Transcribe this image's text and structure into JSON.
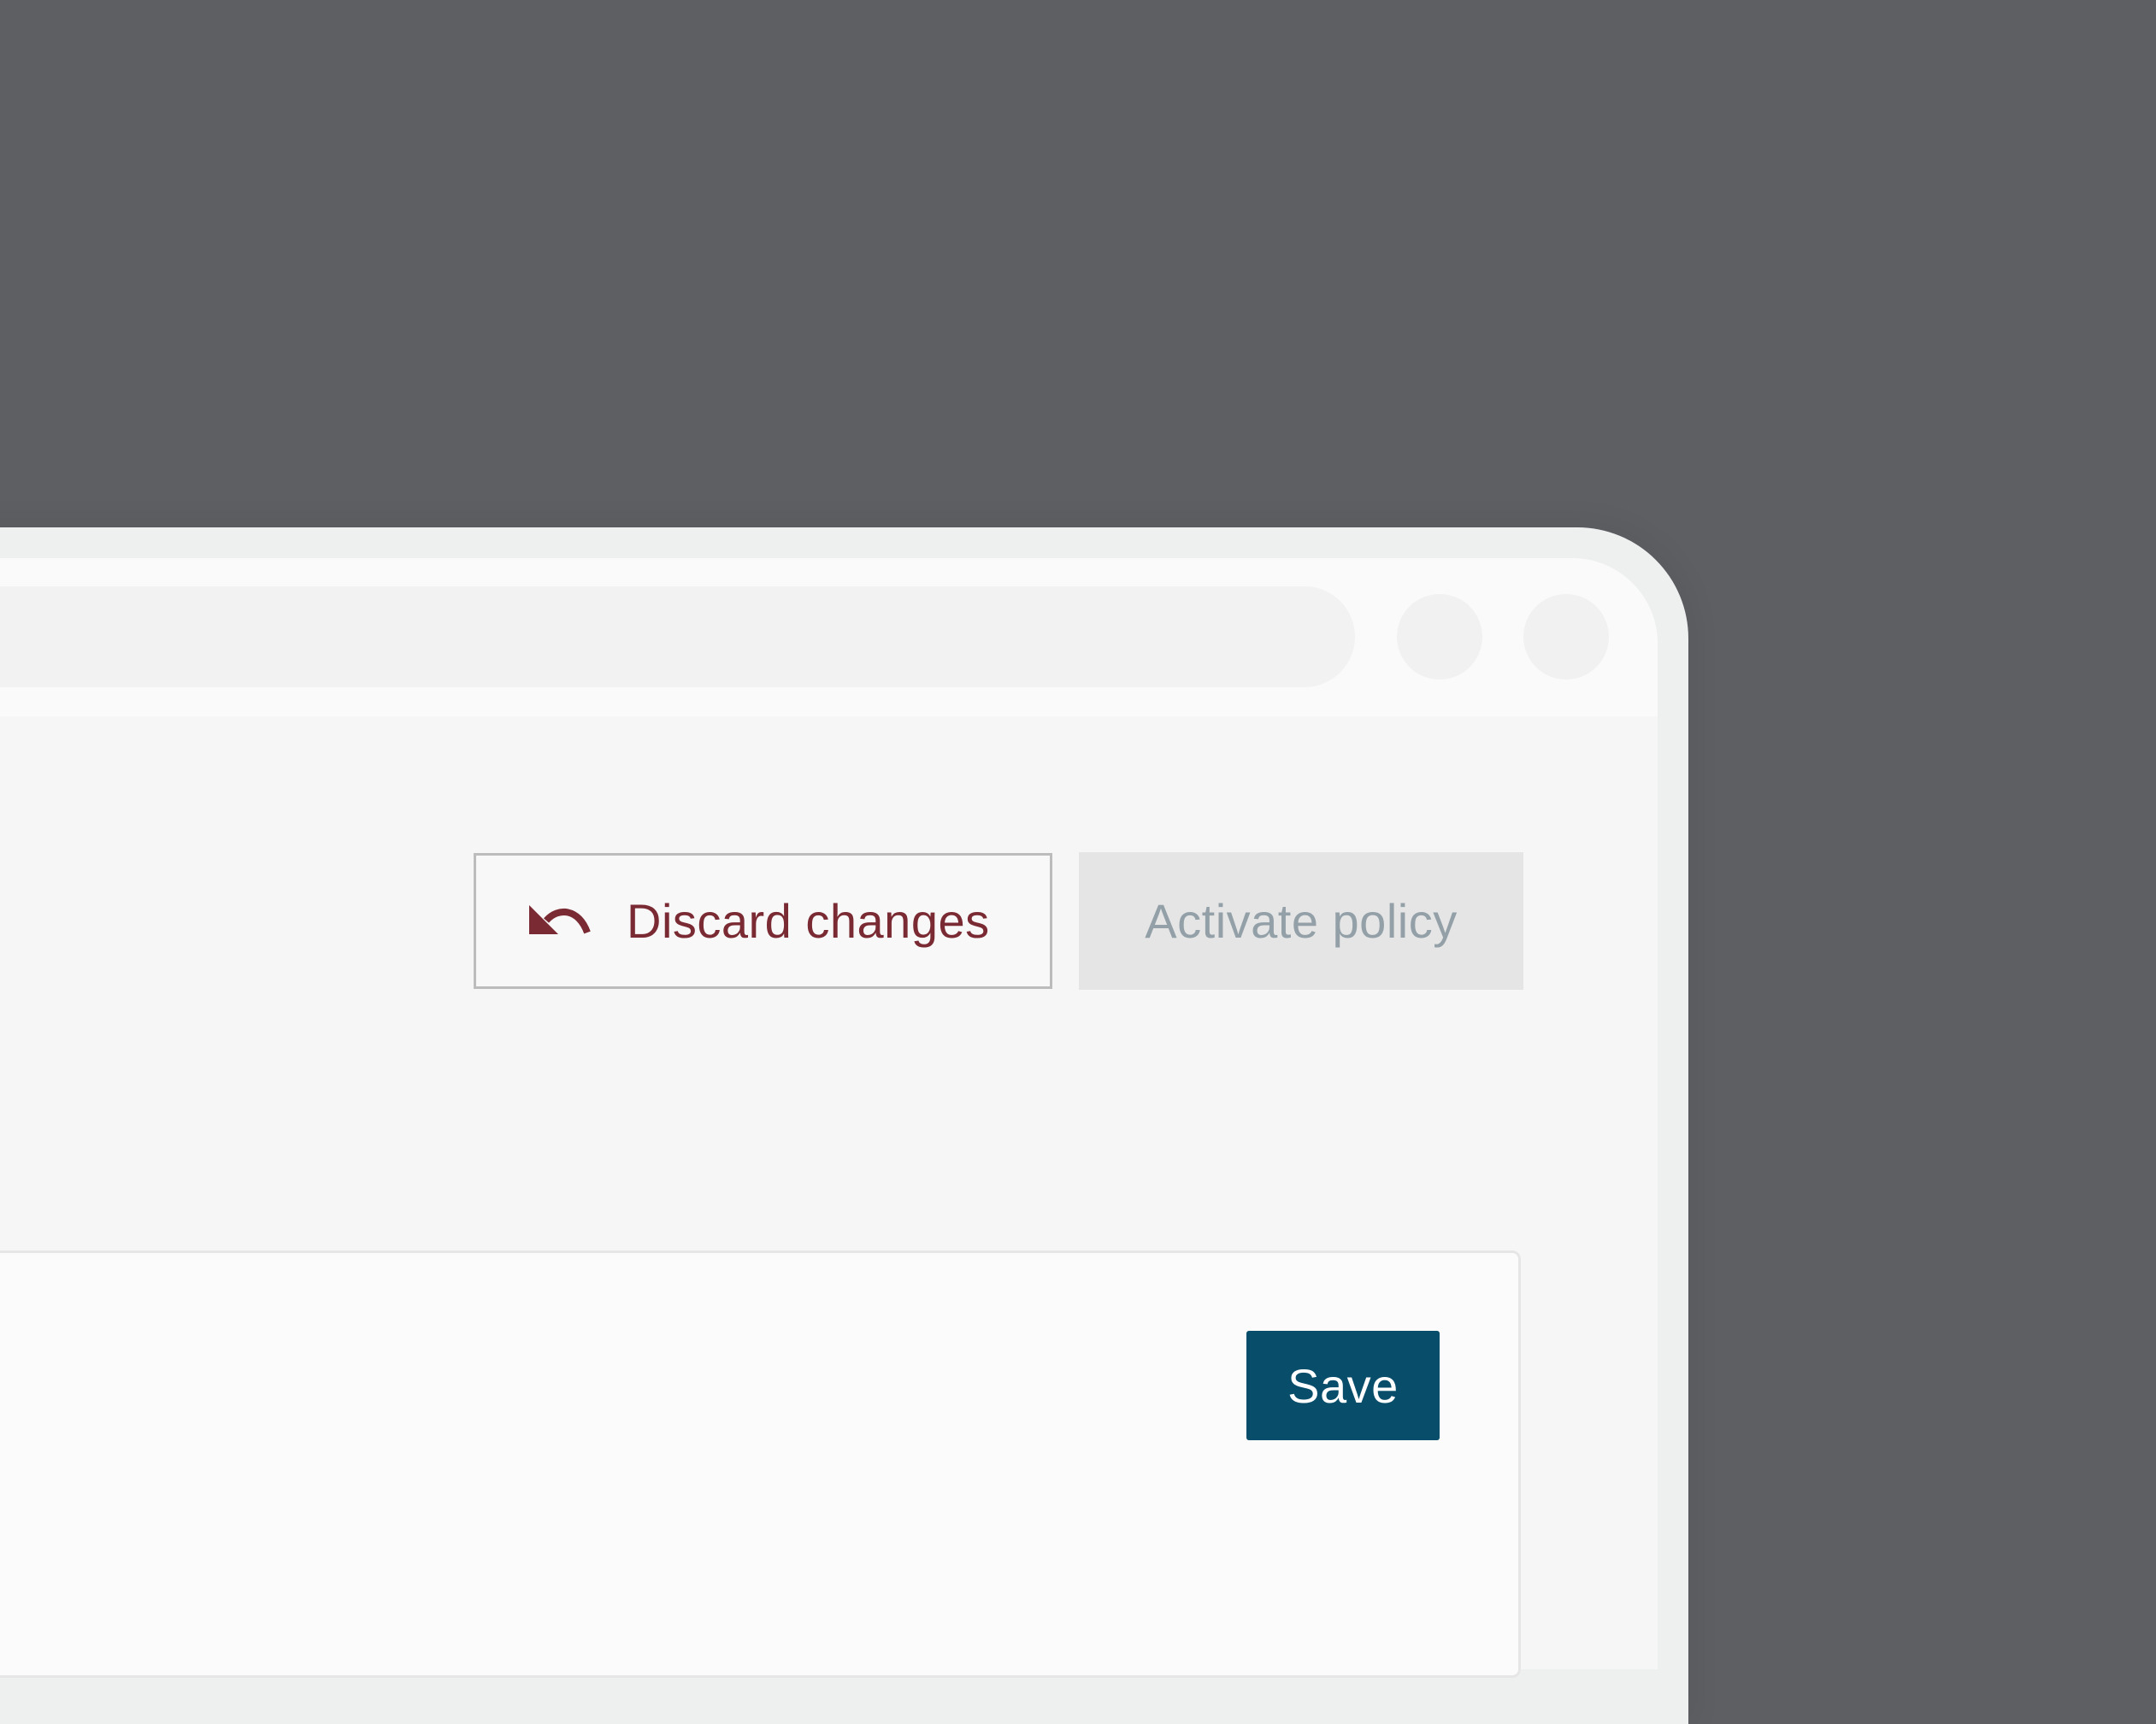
{
  "actions": {
    "discard_label": "Discard changes",
    "discard_icon": "undo-icon",
    "activate_label": "Activate policy",
    "activate_disabled": true
  },
  "card": {
    "save_label": "Save"
  },
  "colors": {
    "backdrop": "#5e5f63",
    "discard_text": "#7a2a33",
    "disabled_text": "#93a0a8",
    "primary": "#084d6a"
  }
}
